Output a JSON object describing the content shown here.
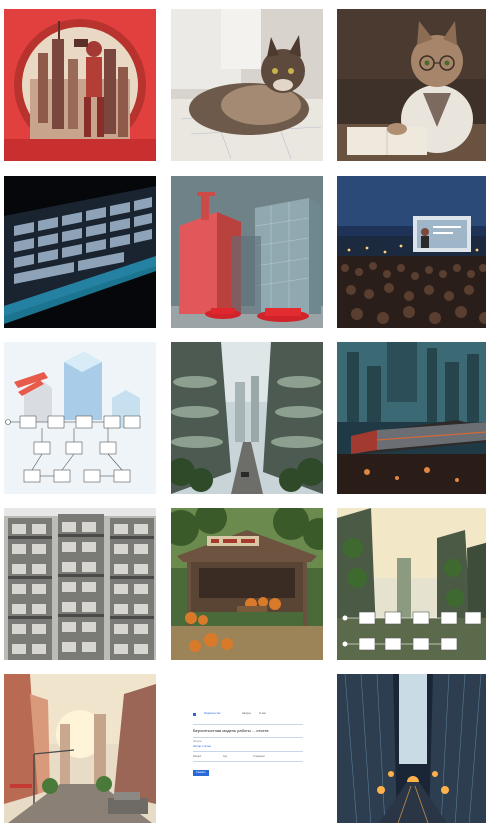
{
  "gallery": {
    "columns": 3,
    "rows": 5,
    "tiles": [
      {
        "subject": "red-engraving-figure-city"
      },
      {
        "subject": "fluffy-cat-on-blueprints"
      },
      {
        "subject": "tabby-cat-with-glasses-reading"
      },
      {
        "subject": "rgb-gaming-keyboard"
      },
      {
        "subject": "modern-towers-red-cars"
      },
      {
        "subject": "outdoor-screen-crowd-night"
      },
      {
        "subject": "isometric-building-flowchart"
      },
      {
        "subject": "futuristic-green-street"
      },
      {
        "subject": "sci-fi-train-city"
      },
      {
        "subject": "dense-apartment-block"
      },
      {
        "subject": "rustic-market-stall-pumpkins"
      },
      {
        "subject": "green-towers-flowchart"
      },
      {
        "subject": "sunny-city-street"
      },
      {
        "subject": "web-document-screenshot"
      },
      {
        "subject": "neon-canyon-city-night"
      }
    ]
  },
  "doc_tile": {
    "brand": "Издательство",
    "nav_1": "Авторы",
    "nav_2": "О нас",
    "title": "Вероятностная модель работы ... отчета",
    "section_1": "Авторы",
    "link_1": "Автор статьи",
    "meta_1": "Раздел",
    "meta_2": "Год",
    "meta_3": "Страницы",
    "button": "Скачать"
  },
  "colors": {
    "doc_link": "#2a6ad8"
  }
}
